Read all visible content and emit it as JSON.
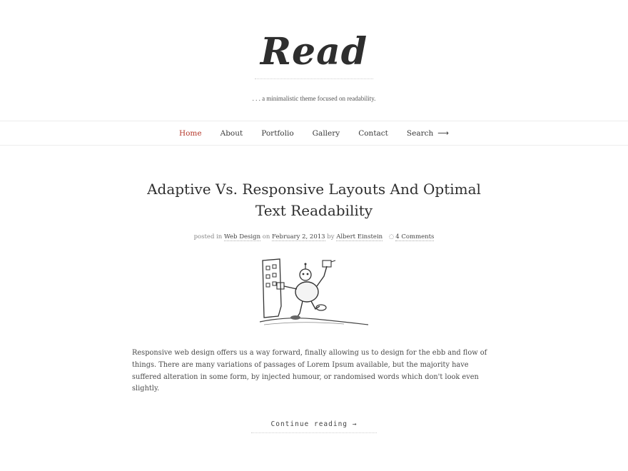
{
  "site": {
    "logo": "Read",
    "tagline": ". . . a minimalistic theme focused on readability."
  },
  "nav": {
    "items": [
      {
        "label": "Home",
        "active": true
      },
      {
        "label": "About"
      },
      {
        "label": "Portfolio"
      },
      {
        "label": "Gallery"
      },
      {
        "label": "Contact"
      }
    ],
    "search_label": "Search",
    "search_icon": "arrow-right-icon"
  },
  "post": {
    "title": "Adaptive Vs. Responsive Layouts And Optimal Text Readability",
    "meta": {
      "posted_in_label": "posted in",
      "category": "Web Design",
      "on_label": "on",
      "date": "February 2, 2013",
      "by_label": "by",
      "author": "Albert Einstein",
      "comments": "4 Comments"
    },
    "image_alt": "robot sketch",
    "excerpt": "Responsive web design offers us a way forward, finally allowing us to design for the ebb and flow of things. There are many variations of passages of Lorem Ipsum available, but the majority have suffered alteration in some form, by injected humour, or randomised words which don't look even slightly.",
    "continue_label": "Continue reading →"
  },
  "colors": {
    "accent": "#b5382b",
    "text": "#333333"
  }
}
